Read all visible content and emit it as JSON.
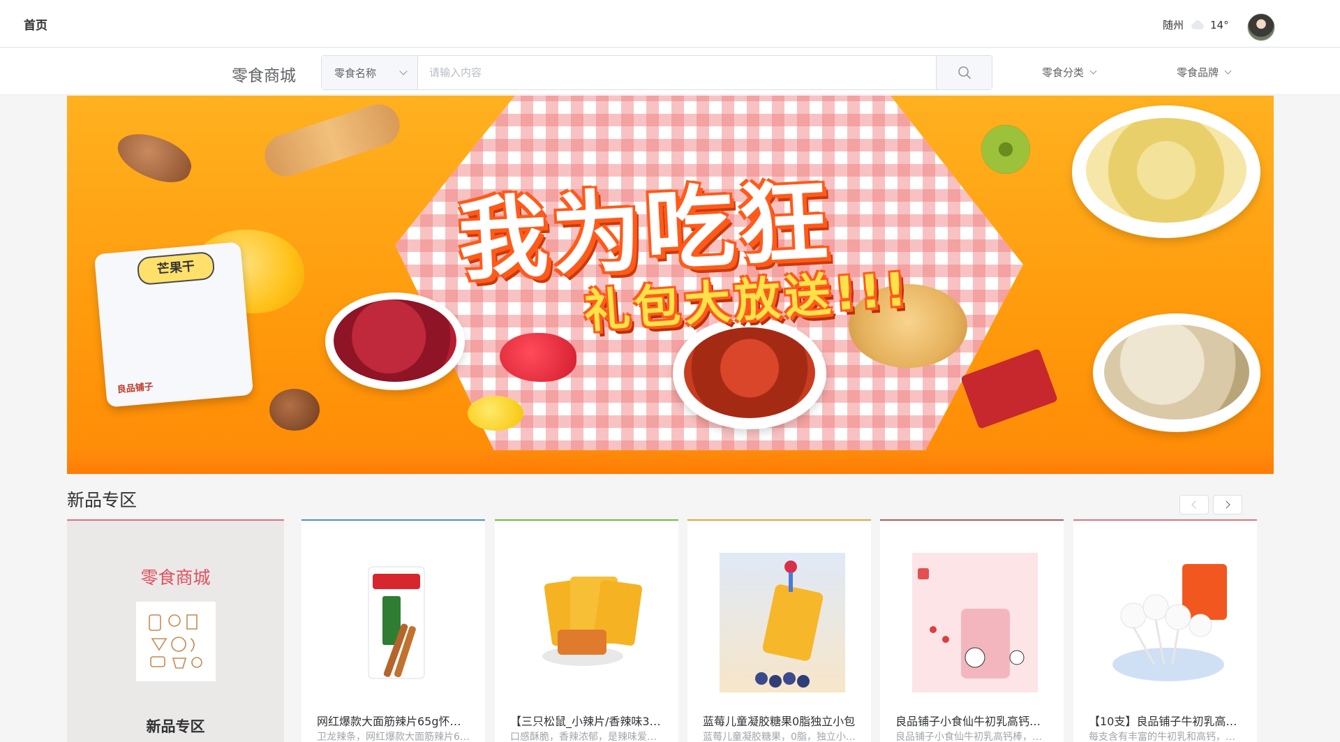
{
  "topbar": {
    "home_label": "首页",
    "city": "随州",
    "weather_icon": "cloudy-icon",
    "temperature": "14°"
  },
  "search": {
    "brand": "零食商城",
    "select_value": "零食名称",
    "placeholder": "请输入内容",
    "category_dropdown": "零食分类",
    "brand_dropdown": "零食品牌"
  },
  "banner": {
    "headline": "我为吃狂",
    "subline": "礼包大放送!!!",
    "pouch_label": "芒果干",
    "pouch_brand": "良品铺子"
  },
  "new_section": {
    "title": "新品专区",
    "feature": {
      "title": "零食商城",
      "label": "新品专区"
    },
    "products": [
      {
        "name": "网红爆款大面筋辣片65g怀旧…",
        "desc": "卫龙辣条，网红爆款大面筋辣片6…",
        "border": "#4a8fd1"
      },
      {
        "name": "【三只松鼠_小辣片/香辣味3…",
        "desc": "口感酥脆，香辣浓郁，是辣味爱好…",
        "border": "#67c23a"
      },
      {
        "name": "蓝莓儿童凝胶糖果0脂独立小包",
        "desc": "蓝莓儿童凝胶糖果，0脂，独立小…",
        "border": "#e6a23c"
      },
      {
        "name": "良品铺子小食仙牛初乳高钙…",
        "desc": "良品铺子小食仙牛初乳高钙棒，山…",
        "border": "#b05a5a"
      },
      {
        "name": "【10支】良品铺子牛初乳高…",
        "desc": "每支含有丰富的牛初乳和高钙，口…",
        "border": "#e0717f"
      }
    ]
  },
  "colors": {
    "accent": "#e0505d",
    "banner": "#ff9a0c"
  }
}
